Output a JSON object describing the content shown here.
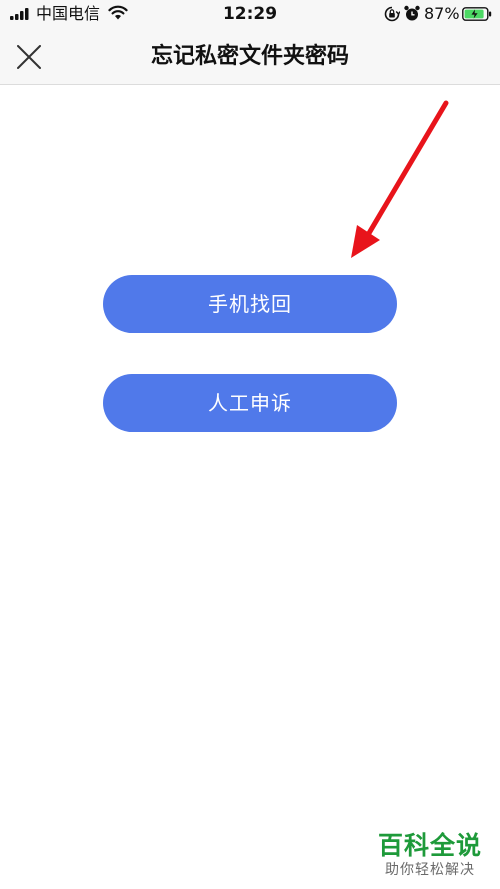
{
  "status_bar": {
    "carrier": "中国电信",
    "time": "12:29",
    "battery_percent": "87%",
    "icons": [
      "signal-icon",
      "wifi-icon",
      "rotation-lock-icon",
      "alarm-icon",
      "battery-icon"
    ]
  },
  "nav": {
    "title": "忘记私密文件夹密码",
    "close_icon": "close-icon"
  },
  "actions": {
    "phone_recover_label": "手机找回",
    "manual_appeal_label": "人工申诉"
  },
  "annotation": {
    "arrow_icon": "red-arrow-icon",
    "color": "#e8141b"
  },
  "watermark": {
    "title": "百科全说",
    "subtitle": "助你轻松解决"
  },
  "colors": {
    "button": "#5079ea",
    "nav_background": "#f7f7f7",
    "watermark_green": "#1e9a3a"
  }
}
